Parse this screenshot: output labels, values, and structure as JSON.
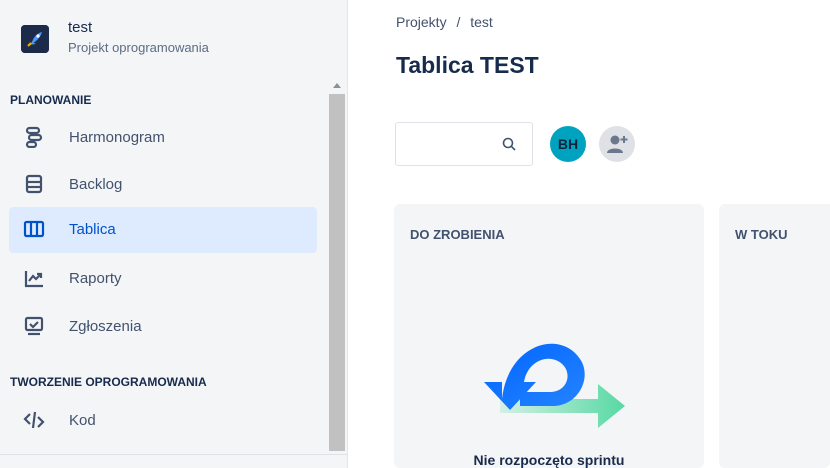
{
  "project": {
    "name": "test",
    "type": "Projekt oprogramowania"
  },
  "sidebar": {
    "section_planning": "PLANOWANIE",
    "section_dev": "TWORZENIE OPROGRAMOWANIA",
    "items": [
      {
        "label": "Harmonogram",
        "icon": "roadmap-icon"
      },
      {
        "label": "Backlog",
        "icon": "backlog-icon"
      },
      {
        "label": "Tablica",
        "icon": "board-icon",
        "active": true
      },
      {
        "label": "Raporty",
        "icon": "reports-icon"
      },
      {
        "label": "Zgłoszenia",
        "icon": "issues-icon"
      },
      {
        "label": "Kod",
        "icon": "code-icon"
      }
    ]
  },
  "breadcrumb": {
    "projects": "Projekty",
    "separator": "/",
    "current": "test"
  },
  "page": {
    "title": "Tablica TEST"
  },
  "toolbar": {
    "search_placeholder": "",
    "avatar_initials": "BH"
  },
  "columns": [
    {
      "title": "DO ZROBIENIA"
    },
    {
      "title": "W TOKU"
    }
  ],
  "empty_state": {
    "title": "Nie rozpoczęto sprintu"
  },
  "colors": {
    "accent": "#0052cc",
    "active_bg": "#deebff",
    "avatar_bg": "#00a3bf",
    "sidebar_bg": "#f4f5f7"
  }
}
